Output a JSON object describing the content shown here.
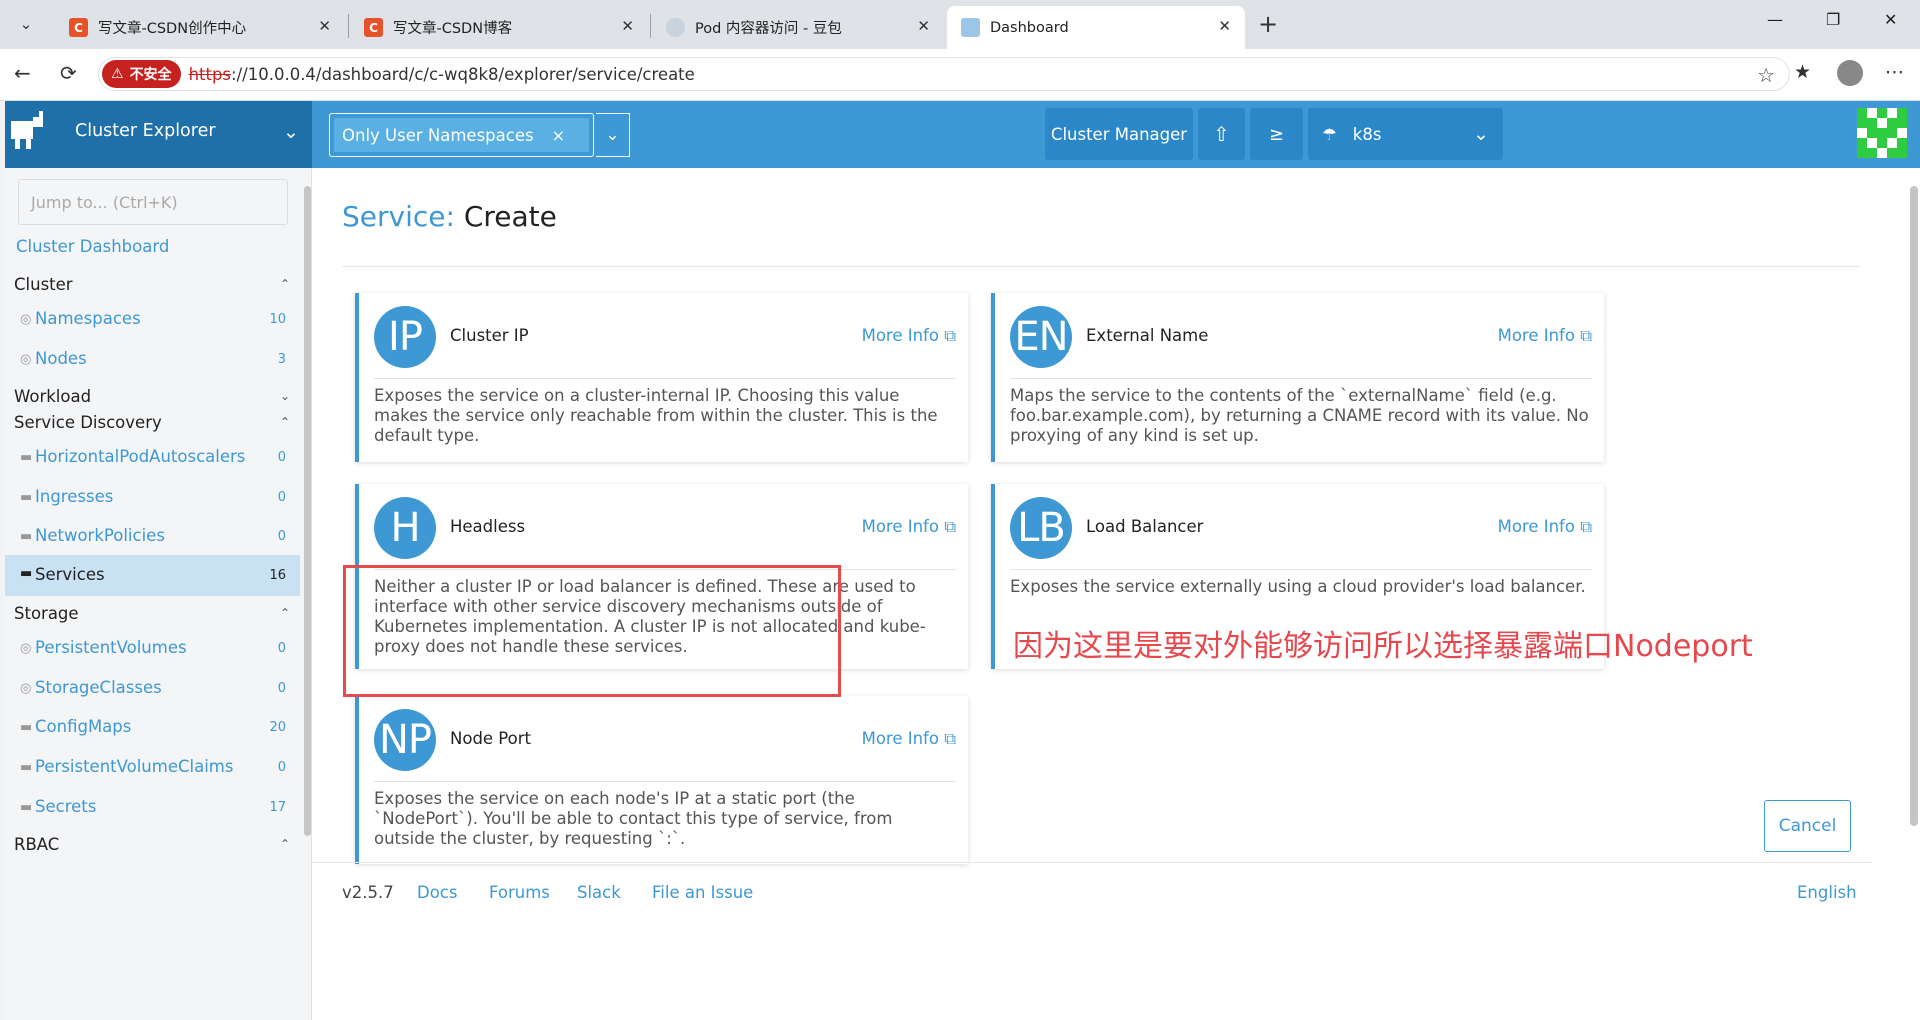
{
  "browser": {
    "tabs": [
      {
        "title": "写文章-CSDN创作中心",
        "favicon": "csdn-icon",
        "active": false
      },
      {
        "title": "写文章-CSDN博客",
        "favicon": "csdn-icon",
        "active": false
      },
      {
        "title": "Pod 内容器访问 - 豆包",
        "favicon": "doubao-icon",
        "active": false
      },
      {
        "title": "Dashboard",
        "favicon": "rancher-icon",
        "active": true
      }
    ],
    "security_label": "不安全",
    "url_scheme": "https",
    "url_rest": "://10.0.0.4/dashboard/c/c-wq8k8/explorer/service/create",
    "favicon_letter": "C",
    "csdn_color": "#e8522b"
  },
  "header": {
    "brand_title": "Cluster Explorer",
    "namespace_filter": "Only User Namespaces",
    "cluster_manager": "Cluster Manager",
    "cluster_name": "k8s",
    "accent_color": "#3d98d3"
  },
  "sidebar": {
    "jump_placeholder": "Jump to... (Ctrl+K)",
    "dashboard_link": "Cluster Dashboard",
    "groups": {
      "cluster": "Cluster",
      "workload": "Workload",
      "service_discovery": "Service Discovery",
      "storage": "Storage",
      "rbac": "RBAC"
    },
    "items": {
      "namespaces": {
        "label": "Namespaces",
        "count": "10"
      },
      "nodes": {
        "label": "Nodes",
        "count": "3"
      },
      "hpa": {
        "label": "HorizontalPodAutoscalers",
        "count": "0"
      },
      "ingresses": {
        "label": "Ingresses",
        "count": "0"
      },
      "networkpolicies": {
        "label": "NetworkPolicies",
        "count": "0"
      },
      "services": {
        "label": "Services",
        "count": "16"
      },
      "pv": {
        "label": "PersistentVolumes",
        "count": "0"
      },
      "storageclasses": {
        "label": "StorageClasses",
        "count": "0"
      },
      "configmaps": {
        "label": "ConfigMaps",
        "count": "20"
      },
      "pvc": {
        "label": "PersistentVolumeClaims",
        "count": "0"
      },
      "secrets": {
        "label": "Secrets",
        "count": "17"
      }
    }
  },
  "page": {
    "title_prefix": "Service:",
    "title_rest": "Create",
    "more_info": "More Info",
    "cards": {
      "clusterip": {
        "badge": "IP",
        "name": "Cluster IP",
        "desc": "Exposes the service on a cluster-internal IP. Choosing this value makes the service only reachable from within the cluster. This is the default type."
      },
      "externalname": {
        "badge": "EN",
        "name": "External Name",
        "desc": "Maps the service to the contents of the `externalName` field (e.g. foo.bar.example.com), by returning a CNAME record with its value. No proxying of any kind is set up."
      },
      "headless": {
        "badge": "H",
        "name": "Headless",
        "desc": "Neither a cluster IP or load balancer is defined. These are used to interface with other service discovery mechanisms outside of Kubernetes implementation. A cluster IP is not allocated and kube-proxy does not handle these services."
      },
      "loadbalancer": {
        "badge": "LB",
        "name": "Load Balancer",
        "desc": "Exposes the service externally using a cloud provider's load balancer."
      },
      "nodeport": {
        "badge": "NP",
        "name": "Node Port",
        "desc": "Exposes the service on each node's IP at a static port (the `NodePort`). You'll be able to contact this type of service, from outside the cluster, by requesting `:`."
      }
    },
    "annotation": "因为这里是要对外能够访问所以选择暴露端口Nodeport",
    "annotation_color": "#e5484d",
    "cancel": "Cancel"
  },
  "footer": {
    "version": "v2.5.7",
    "docs": "Docs",
    "forums": "Forums",
    "slack": "Slack",
    "issue": "File an Issue",
    "language": "English"
  }
}
